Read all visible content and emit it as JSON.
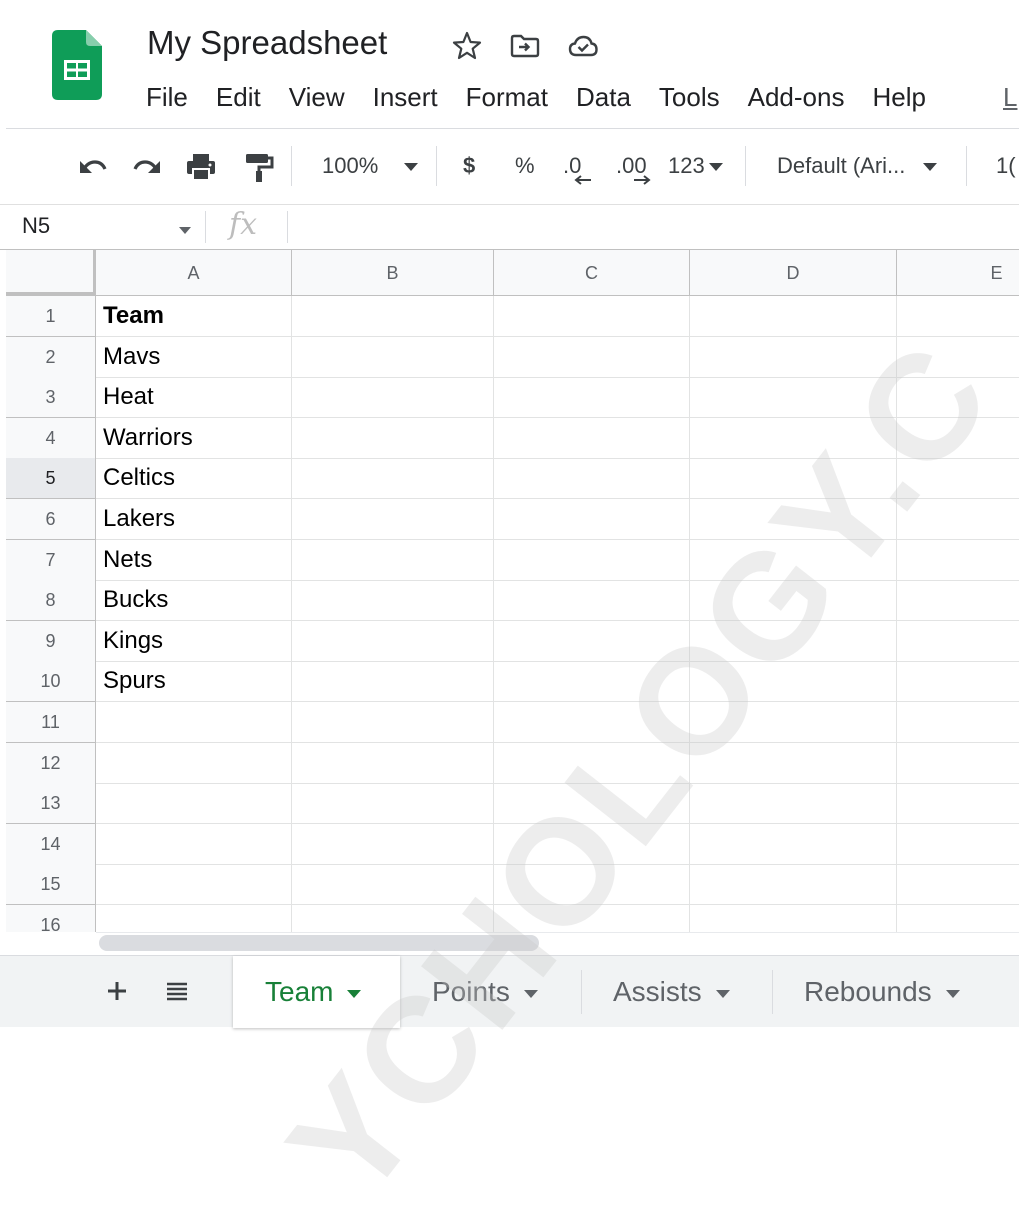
{
  "document": {
    "title": "My Spreadsheet"
  },
  "menu": [
    "File",
    "Edit",
    "View",
    "Insert",
    "Format",
    "Data",
    "Tools",
    "Add-ons",
    "Help"
  ],
  "menu_cut_text": "L",
  "toolbar": {
    "zoom": "100%",
    "currency": "$",
    "percent": "%",
    "decrease_decimals": ".0",
    "increase_decimals": ".00",
    "more_formats": "123",
    "font": "Default (Ari...",
    "font_size_cut": "1("
  },
  "formula_bar": {
    "cell_ref": "N5",
    "fx_label": "fx"
  },
  "columns": [
    "A",
    "B",
    "C",
    "D",
    "E"
  ],
  "rows": [
    {
      "num": "1",
      "a": "Team",
      "bold": true
    },
    {
      "num": "2",
      "a": "Mavs"
    },
    {
      "num": "3",
      "a": "Heat"
    },
    {
      "num": "4",
      "a": "Warriors"
    },
    {
      "num": "5",
      "a": "Celtics",
      "selected": true
    },
    {
      "num": "6",
      "a": "Lakers"
    },
    {
      "num": "7",
      "a": "Nets"
    },
    {
      "num": "8",
      "a": "Bucks"
    },
    {
      "num": "9",
      "a": "Kings"
    },
    {
      "num": "10",
      "a": "Spurs"
    },
    {
      "num": "11",
      "a": ""
    },
    {
      "num": "12",
      "a": ""
    },
    {
      "num": "13",
      "a": ""
    },
    {
      "num": "14",
      "a": ""
    },
    {
      "num": "15",
      "a": ""
    },
    {
      "num": "16",
      "a": ""
    }
  ],
  "sheets": [
    {
      "name": "Team",
      "active": true
    },
    {
      "name": "Points"
    },
    {
      "name": "Assists"
    },
    {
      "name": "Rebounds"
    }
  ],
  "watermark": "YCHOLOGY.C",
  "colors": {
    "brand_green": "#188038",
    "logo_green": "#0f9d58"
  }
}
